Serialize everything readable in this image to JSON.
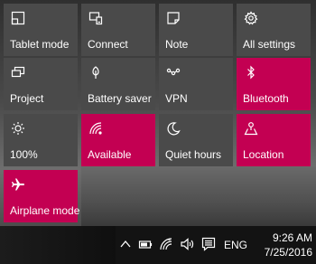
{
  "tiles": [
    {
      "label": "Tablet mode",
      "icon": "tablet-mode-icon",
      "active": false
    },
    {
      "label": "Connect",
      "icon": "connect-icon",
      "active": false
    },
    {
      "label": "Note",
      "icon": "note-icon",
      "active": false
    },
    {
      "label": "All settings",
      "icon": "gear-icon",
      "active": false
    },
    {
      "label": "Project",
      "icon": "project-icon",
      "active": false
    },
    {
      "label": "Battery saver",
      "icon": "battery-saver-icon",
      "active": false
    },
    {
      "label": "VPN",
      "icon": "vpn-icon",
      "active": false
    },
    {
      "label": "Bluetooth",
      "icon": "bluetooth-icon",
      "active": true
    },
    {
      "label": "100%",
      "icon": "brightness-icon",
      "active": false
    },
    {
      "label": "Available",
      "icon": "wifi-icon",
      "active": true
    },
    {
      "label": "Quiet hours",
      "icon": "moon-icon",
      "active": false
    },
    {
      "label": "Location",
      "icon": "location-icon",
      "active": true
    },
    {
      "label": "Airplane mode",
      "icon": "airplane-icon",
      "active": true
    }
  ],
  "taskbar": {
    "language": "ENG",
    "time": "9:26 AM",
    "date": "7/25/2016",
    "tray_icons": [
      "chevron-up-icon",
      "battery-icon",
      "wifi-icon",
      "volume-icon",
      "notifications-icon"
    ]
  },
  "colors": {
    "accent": "#c30052",
    "tile_inactive": "#4a4a4a",
    "taskbar": "#131313"
  }
}
